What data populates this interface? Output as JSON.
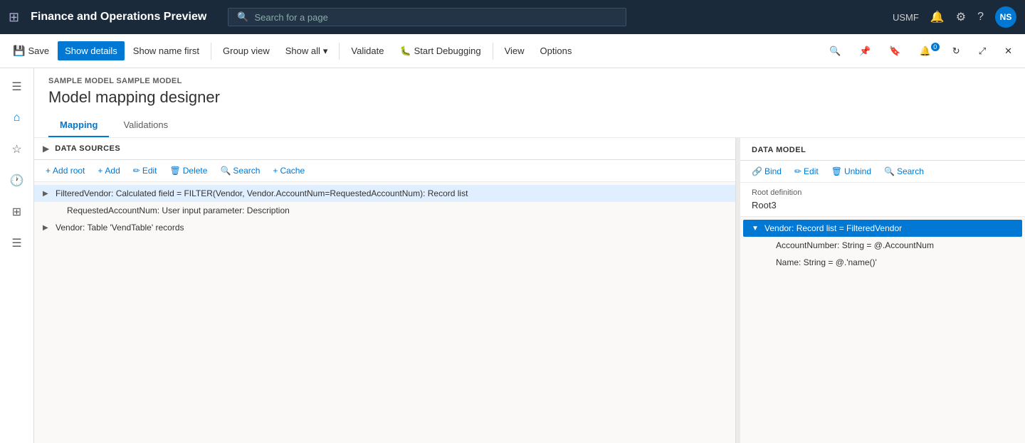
{
  "app": {
    "title": "Finance and Operations Preview",
    "search_placeholder": "Search for a page"
  },
  "top_nav": {
    "usmf_label": "USMF",
    "avatar_initials": "NS"
  },
  "toolbar": {
    "save_label": "Save",
    "show_details_label": "Show details",
    "show_name_first_label": "Show name first",
    "group_view_label": "Group view",
    "show_all_label": "Show all",
    "validate_label": "Validate",
    "start_debugging_label": "Start Debugging",
    "view_label": "View",
    "options_label": "Options"
  },
  "breadcrumb": {
    "text": "SAMPLE MODEL SAMPLE MODEL"
  },
  "page": {
    "title": "Model mapping designer"
  },
  "tabs": [
    {
      "label": "Mapping",
      "active": true
    },
    {
      "label": "Validations",
      "active": false
    }
  ],
  "data_sources": {
    "panel_title": "DATA SOURCES",
    "toolbar_items": [
      {
        "label": "Add root",
        "icon": "+"
      },
      {
        "label": "Add",
        "icon": "+"
      },
      {
        "label": "Edit",
        "icon": "✏"
      },
      {
        "label": "Delete",
        "icon": "🗑"
      },
      {
        "label": "Search",
        "icon": "🔍"
      },
      {
        "label": "Cache",
        "icon": "📦"
      }
    ],
    "tree_items": [
      {
        "id": "filtered-vendor",
        "text": "FilteredVendor: Calculated field = FILTER(Vendor, Vendor.AccountNum=RequestedAccountNum): Record list",
        "expanded": true,
        "level": 0,
        "selected": false
      },
      {
        "id": "requested-account-num",
        "text": "RequestedAccountNum: User input parameter: Description",
        "expanded": false,
        "level": 1,
        "selected": false
      },
      {
        "id": "vendor",
        "text": "Vendor: Table 'VendTable' records",
        "expanded": false,
        "level": 0,
        "selected": false
      }
    ]
  },
  "data_model": {
    "panel_title": "DATA MODEL",
    "toolbar_items": [
      {
        "label": "Bind",
        "icon": "🔗"
      },
      {
        "label": "Edit",
        "icon": "✏"
      },
      {
        "label": "Unbind",
        "icon": "🗑"
      },
      {
        "label": "Search",
        "icon": "🔍"
      }
    ],
    "root_definition_label": "Root definition",
    "root_definition_value": "Root3",
    "tree_items": [
      {
        "id": "vendor-record",
        "text": "Vendor: Record list = FilteredVendor",
        "expanded": true,
        "level": 0,
        "selected": true
      },
      {
        "id": "account-number",
        "text": "AccountNumber: String = @.AccountNum",
        "level": 1,
        "selected": false
      },
      {
        "id": "name",
        "text": "Name: String = @.'name()'",
        "level": 1,
        "selected": false
      }
    ]
  }
}
